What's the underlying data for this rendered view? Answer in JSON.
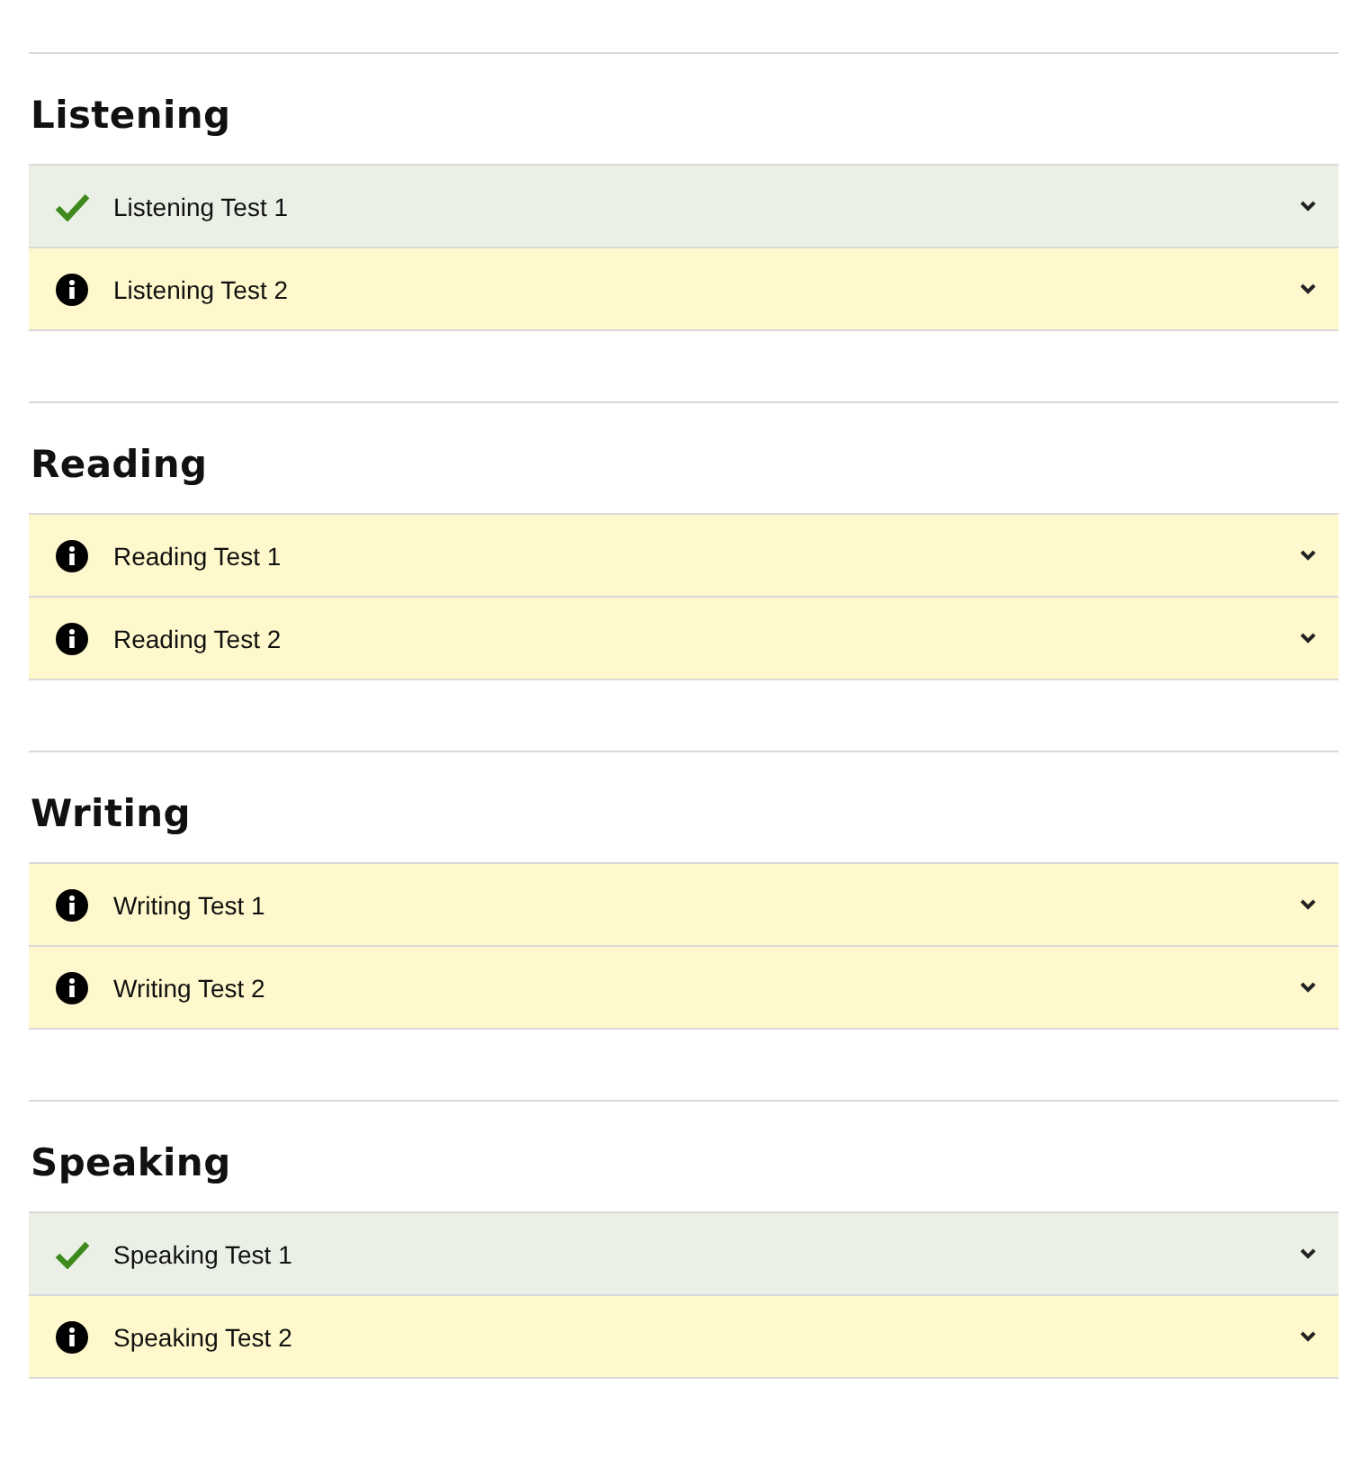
{
  "sections": [
    {
      "title": "Listening",
      "tests": [
        {
          "label": "Listening Test 1",
          "completed": true,
          "expanded": false
        },
        {
          "label": "Listening Test 2",
          "completed": false,
          "expanded": false
        }
      ]
    },
    {
      "title": "Reading",
      "tests": [
        {
          "label": "Reading Test 1",
          "completed": false,
          "expanded": false
        },
        {
          "label": "Reading Test 2",
          "completed": false,
          "expanded": false
        }
      ]
    },
    {
      "title": "Writing",
      "tests": [
        {
          "label": "Writing Test 1",
          "completed": false,
          "expanded": false
        },
        {
          "label": "Writing Test 2",
          "completed": false,
          "expanded": false
        }
      ]
    },
    {
      "title": "Speaking",
      "tests": [
        {
          "label": "Speaking Test 1",
          "completed": true,
          "expanded": false
        },
        {
          "label": "Speaking Test 2",
          "completed": false,
          "expanded": false
        }
      ]
    }
  ]
}
